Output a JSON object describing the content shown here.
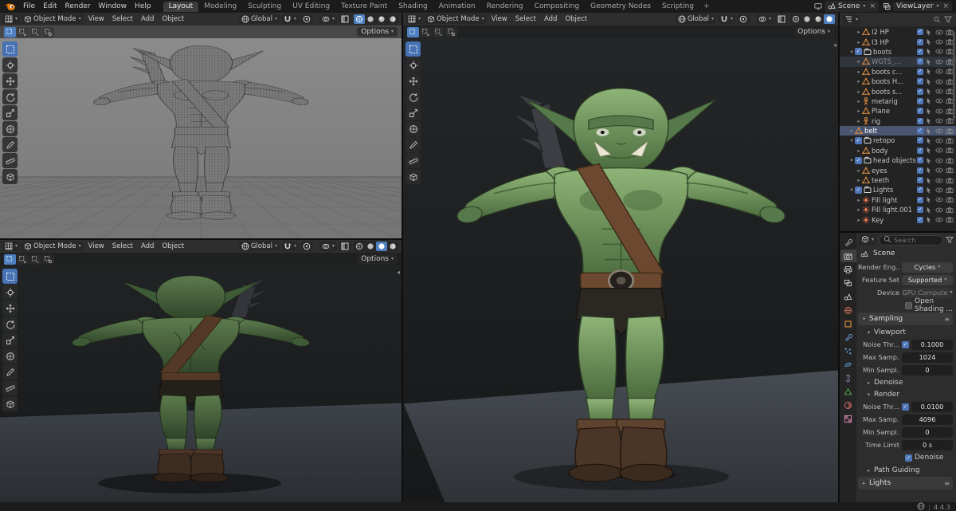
{
  "topbar": {
    "menus": [
      "File",
      "Edit",
      "Render",
      "Window",
      "Help"
    ],
    "workspaces": [
      "Layout",
      "Modeling",
      "Sculpting",
      "UV Editing",
      "Texture Paint",
      "Shading",
      "Animation",
      "Rendering",
      "Compositing",
      "Geometry Nodes",
      "Scripting"
    ],
    "active_workspace": "Layout",
    "add_workspace_label": "+",
    "scene_label": "Scene",
    "viewlayer_label": "ViewLayer"
  },
  "viewport_common": {
    "mode": "Object Mode",
    "menus": [
      "View",
      "Select",
      "Add",
      "Object"
    ],
    "orientation": "Global",
    "options_label": "Options"
  },
  "toolbar_tools": [
    "select-box-tool",
    "cursor-tool",
    "move-tool",
    "rotate-tool",
    "scale-tool",
    "transform-tool",
    "annotate-tool",
    "measure-tool",
    "add-cube-tool"
  ],
  "shading_modes": [
    "wireframe",
    "solid",
    "material-preview",
    "rendered"
  ],
  "viewport_shading": {
    "wire": "wireframe",
    "back": "material-preview",
    "front": "rendered"
  },
  "outliner": {
    "items": [
      {
        "chev": ">",
        "icon": "mesh",
        "label": "I2 HP",
        "indent": 2
      },
      {
        "chev": ">",
        "icon": "mesh",
        "label": "I3 HP",
        "indent": 2
      },
      {
        "chev": "v",
        "checkbox": true,
        "icon": "collection",
        "label": "boots",
        "indent": 1
      },
      {
        "chev": ">",
        "icon": "mesh",
        "label": "WGTS_...",
        "indent": 2,
        "selected": true,
        "muted": true
      },
      {
        "chev": ">",
        "icon": "mesh",
        "label": "boots c...",
        "indent": 2
      },
      {
        "chev": ">",
        "icon": "mesh",
        "label": "boots H...",
        "indent": 2
      },
      {
        "chev": ">",
        "icon": "mesh",
        "label": "boots s...",
        "indent": 2
      },
      {
        "chev": ">",
        "icon": "armature",
        "label": "metarig",
        "indent": 2
      },
      {
        "chev": ">",
        "icon": "mesh",
        "label": "Plane",
        "indent": 2
      },
      {
        "chev": ">",
        "icon": "armature",
        "label": "rig",
        "indent": 2
      },
      {
        "chev": ">",
        "icon": "mesh",
        "label": "belt",
        "indent": 1,
        "active": true
      },
      {
        "chev": "v",
        "checkbox": true,
        "icon": "collection",
        "label": "retopo",
        "indent": 1
      },
      {
        "chev": ">",
        "icon": "mesh",
        "label": "body",
        "indent": 2
      },
      {
        "chev": "v",
        "checkbox": true,
        "icon": "collection",
        "label": "head objects",
        "indent": 1
      },
      {
        "chev": ">",
        "icon": "mesh",
        "label": "eyes",
        "indent": 2
      },
      {
        "chev": ">",
        "icon": "mesh",
        "label": "teeth",
        "indent": 2
      },
      {
        "chev": "v",
        "checkbox": true,
        "icon": "collection",
        "label": "Lights",
        "indent": 1
      },
      {
        "chev": ">",
        "icon": "light",
        "label": "Fill light",
        "indent": 2
      },
      {
        "chev": ">",
        "icon": "light",
        "label": "Fill light.001",
        "indent": 2
      },
      {
        "chev": ">",
        "icon": "light",
        "label": "Key",
        "indent": 2
      }
    ]
  },
  "properties": {
    "search_placeholder": "Search",
    "breadcrumb": "Scene",
    "tabs": [
      "tool",
      "render",
      "output",
      "viewlayer",
      "scene",
      "world",
      "object",
      "modifiers",
      "particles",
      "physics",
      "constraints",
      "data",
      "material",
      "texture"
    ],
    "active_tab": "render",
    "rows": [
      {
        "kind": "setting",
        "label": "Render Eng...",
        "value": "Cycles",
        "widget": "dropdown"
      },
      {
        "kind": "setting",
        "label": "Feature Set",
        "value": "Supported",
        "widget": "dropdown"
      },
      {
        "kind": "setting",
        "label": "Device",
        "value": "GPU Compute",
        "widget": "dropdown",
        "disabled": true
      },
      {
        "kind": "checkrow",
        "label": "Open Shading ...",
        "checked": false
      },
      {
        "kind": "section",
        "label": "Sampling",
        "open": true
      },
      {
        "kind": "subsection",
        "label": "Viewport",
        "open": true,
        "ind": 1
      },
      {
        "kind": "setting",
        "label": "Noise Thr...",
        "value": "0.1000",
        "widget": "number",
        "check": true,
        "ind": 1
      },
      {
        "kind": "setting",
        "label": "Max Samp...",
        "value": "1024",
        "widget": "number",
        "ind": 1
      },
      {
        "kind": "setting",
        "label": "Min Sampl...",
        "value": "0",
        "widget": "number",
        "ind": 1
      },
      {
        "kind": "subsection",
        "label": "Denoise",
        "open": false,
        "ind": 1
      },
      {
        "kind": "subsection",
        "label": "Render",
        "open": true,
        "ind": 1
      },
      {
        "kind": "setting",
        "label": "Noise Thr...",
        "value": "0.0100",
        "widget": "number",
        "check": true,
        "ind": 1
      },
      {
        "kind": "setting",
        "label": "Max Samp...",
        "value": "4096",
        "widget": "number",
        "ind": 1
      },
      {
        "kind": "setting",
        "label": "Min Sampl...",
        "value": "0",
        "widget": "number",
        "ind": 1
      },
      {
        "kind": "setting",
        "label": "Time Limit",
        "value": "0 s",
        "widget": "number",
        "ind": 1
      },
      {
        "kind": "checkrow",
        "label": "Denoise",
        "checked": true,
        "ind": 1
      },
      {
        "kind": "subsection",
        "label": "Path Guiding",
        "open": false,
        "ind": 1
      },
      {
        "kind": "section",
        "label": "Lights",
        "open": false
      }
    ]
  },
  "status": {
    "version": "4.4.3"
  },
  "colors": {
    "accent": "#4772b3",
    "object_orange": "#e8923f",
    "skin_green": "#6f9b5e"
  }
}
